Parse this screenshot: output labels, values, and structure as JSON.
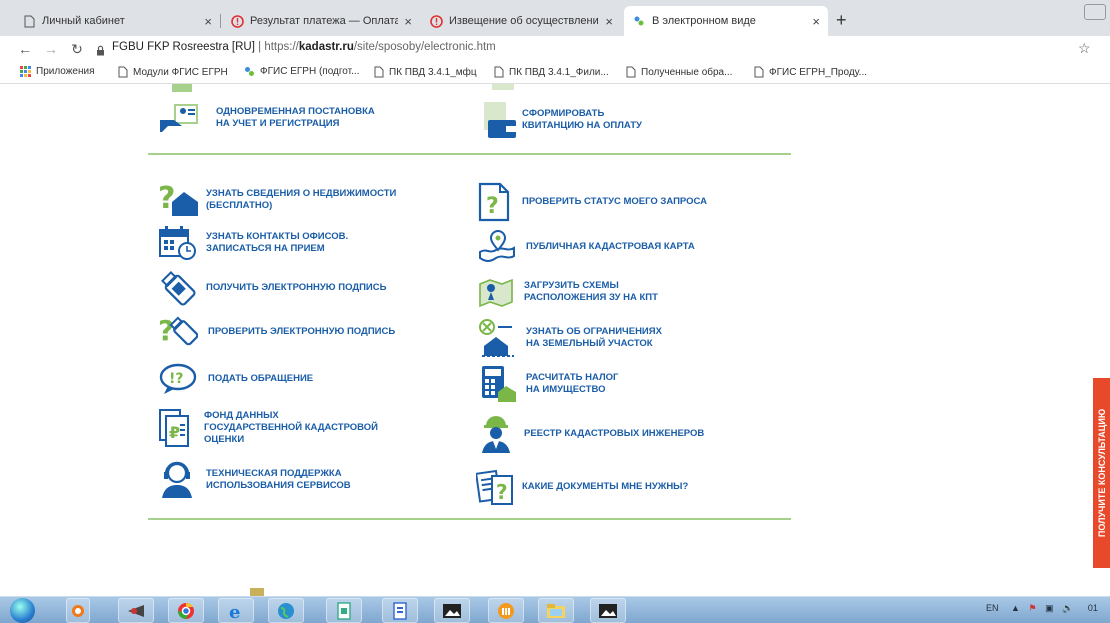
{
  "browser": {
    "tabs": [
      {
        "label": "Личный кабинет",
        "icon": "page-icon"
      },
      {
        "label": "Результат платежа — Оплата го",
        "icon": "error-icon"
      },
      {
        "label": "Извещение об осуществлении",
        "icon": "error-icon"
      },
      {
        "label": "В электронном виде",
        "icon": "rosreestr-icon"
      }
    ],
    "new_tab_label": "+",
    "url_site": "FGBU FKP Rosreestra [RU]",
    "url_separator": "|",
    "url_protocol": "https://",
    "url_host": "kadastr.ru",
    "url_path": "/site/sposoby/electronic.htm",
    "bookmarks": [
      {
        "label": "Приложения",
        "icon": "apps-grid-icon"
      },
      {
        "label": "Модули ФГИС ЕГРН",
        "icon": "page-icon"
      },
      {
        "label": "ФГИС ЕГРН (подгот...",
        "icon": "rosreestr-icon"
      },
      {
        "label": "ПК ПВД 3.4.1_мфц",
        "icon": "page-icon"
      },
      {
        "label": "ПК ПВД 3.4.1_Фили...",
        "icon": "page-icon"
      },
      {
        "label": "Полученные обра...",
        "icon": "page-icon"
      },
      {
        "label": "ФГИС ЕГРН_Проду...",
        "icon": "page-icon"
      }
    ]
  },
  "services": {
    "top_left": {
      "line1": "ОДНОВРЕМЕННАЯ ПОСТАНОВКА",
      "line2": "НА УЧЕТ И РЕГИСТРАЦИЯ"
    },
    "top_right": {
      "line1": "СФОРМИРОВАТЬ",
      "line2": "КВИТАНЦИЮ НА ОПЛАТУ"
    },
    "left": [
      {
        "line1": "УЗНАТЬ СВЕДЕНИЯ О НЕДВИЖИМОСТИ",
        "line2": "(БЕСПЛАТНО)",
        "line3": ""
      },
      {
        "line1": "УЗНАТЬ КОНТАКТЫ ОФИСОВ.",
        "line2": "ЗАПИСАТЬСЯ НА ПРИЕМ",
        "line3": ""
      },
      {
        "line1": "ПОЛУЧИТЬ ЭЛЕКТРОННУЮ ПОДПИСЬ",
        "line2": "",
        "line3": ""
      },
      {
        "line1": "ПРОВЕРИТЬ ЭЛЕКТРОННУЮ ПОДПИСЬ",
        "line2": "",
        "line3": ""
      },
      {
        "line1": "ПОДАТЬ ОБРАЩЕНИЕ",
        "line2": "",
        "line3": ""
      },
      {
        "line1": "ФОНД ДАННЫХ",
        "line2": "ГОСУДАРСТВЕННОЙ КАДАСТРОВОЙ",
        "line3": "ОЦЕНКИ"
      },
      {
        "line1": "ТЕХНИЧЕСКАЯ ПОДДЕРЖКА",
        "line2": "ИСПОЛЬЗОВАНИЯ СЕРВИСОВ",
        "line3": ""
      }
    ],
    "right": [
      {
        "line1": "ПРОВЕРИТЬ СТАТУС МОЕГО ЗАПРОСА",
        "line2": ""
      },
      {
        "line1": "ПУБЛИЧНАЯ КАДАСТРОВАЯ КАРТА",
        "line2": ""
      },
      {
        "line1": "ЗАГРУЗИТЬ СХЕМЫ",
        "line2": "РАСПОЛОЖЕНИЯ ЗУ НА КПТ"
      },
      {
        "line1": "УЗНАТЬ ОБ ОГРАНИЧЕНИЯХ",
        "line2": "НА ЗЕМЕЛЬНЫЙ УЧАСТОК"
      },
      {
        "line1": "РАСЧИТАТЬ НАЛОГ",
        "line2": "НА ИМУЩЕСТВО"
      },
      {
        "line1": "РЕЕСТР КАДАСТРОВЫХ ИНЖЕНЕРОВ",
        "line2": ""
      },
      {
        "line1": "КАКИЕ ДОКУМЕНТЫ МНЕ НУЖНЫ?",
        "line2": ""
      }
    ]
  },
  "consult_button": "ПОЛУЧИТЕ КОНСУЛЬТАЦИЮ",
  "tray": {
    "lang": "EN",
    "clock": "01"
  },
  "colors": {
    "link_blue": "#1a5da8",
    "accent_green": "#7ab648",
    "consult_red": "#e8492a"
  }
}
